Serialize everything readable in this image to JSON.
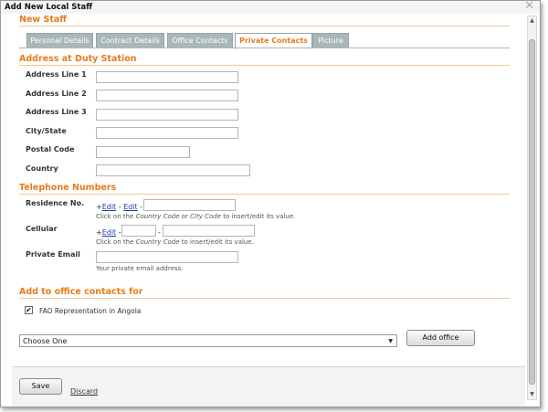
{
  "window": {
    "title": "Add New Local Staff"
  },
  "form": {
    "heading": "New Staff"
  },
  "tabs": [
    {
      "label": "Personal Details"
    },
    {
      "label": "Contract Details"
    },
    {
      "label": "Office Contacts"
    },
    {
      "label": "Private Contacts"
    },
    {
      "label": "Picture"
    }
  ],
  "address": {
    "title": "Address at Duty Station",
    "fields": [
      {
        "label": "Address Line 1",
        "value": ""
      },
      {
        "label": "Address Line 2",
        "value": ""
      },
      {
        "label": "Address Line 3",
        "value": ""
      },
      {
        "label": "City/State",
        "value": ""
      },
      {
        "label": "Postal Code",
        "value": ""
      },
      {
        "label": "Country",
        "value": ""
      }
    ]
  },
  "telephone": {
    "title": "Telephone Numbers",
    "residence_label": "Residence No.",
    "cellular_label": "Cellular",
    "email_label": "Private Email",
    "plus": "+",
    "edit_link": "Edit",
    "dash": "-",
    "residence_hint": {
      "a": "Click on the ",
      "b": "Country Code",
      "c": " or ",
      "d": "City Code",
      "e": " to insert/edit its value."
    },
    "cellular_hint": {
      "a": "Click on the ",
      "b": "Country Code",
      "c": " to insert/edit its value."
    },
    "email_hint": "Your private email address."
  },
  "office_contacts": {
    "title": "Add to office contacts for",
    "checkbox_label": "FAO Representation in Angola",
    "checked": true,
    "select_value": "Choose One",
    "add_button": "Add office"
  },
  "footer": {
    "save": "Save",
    "discard": "Discard"
  }
}
